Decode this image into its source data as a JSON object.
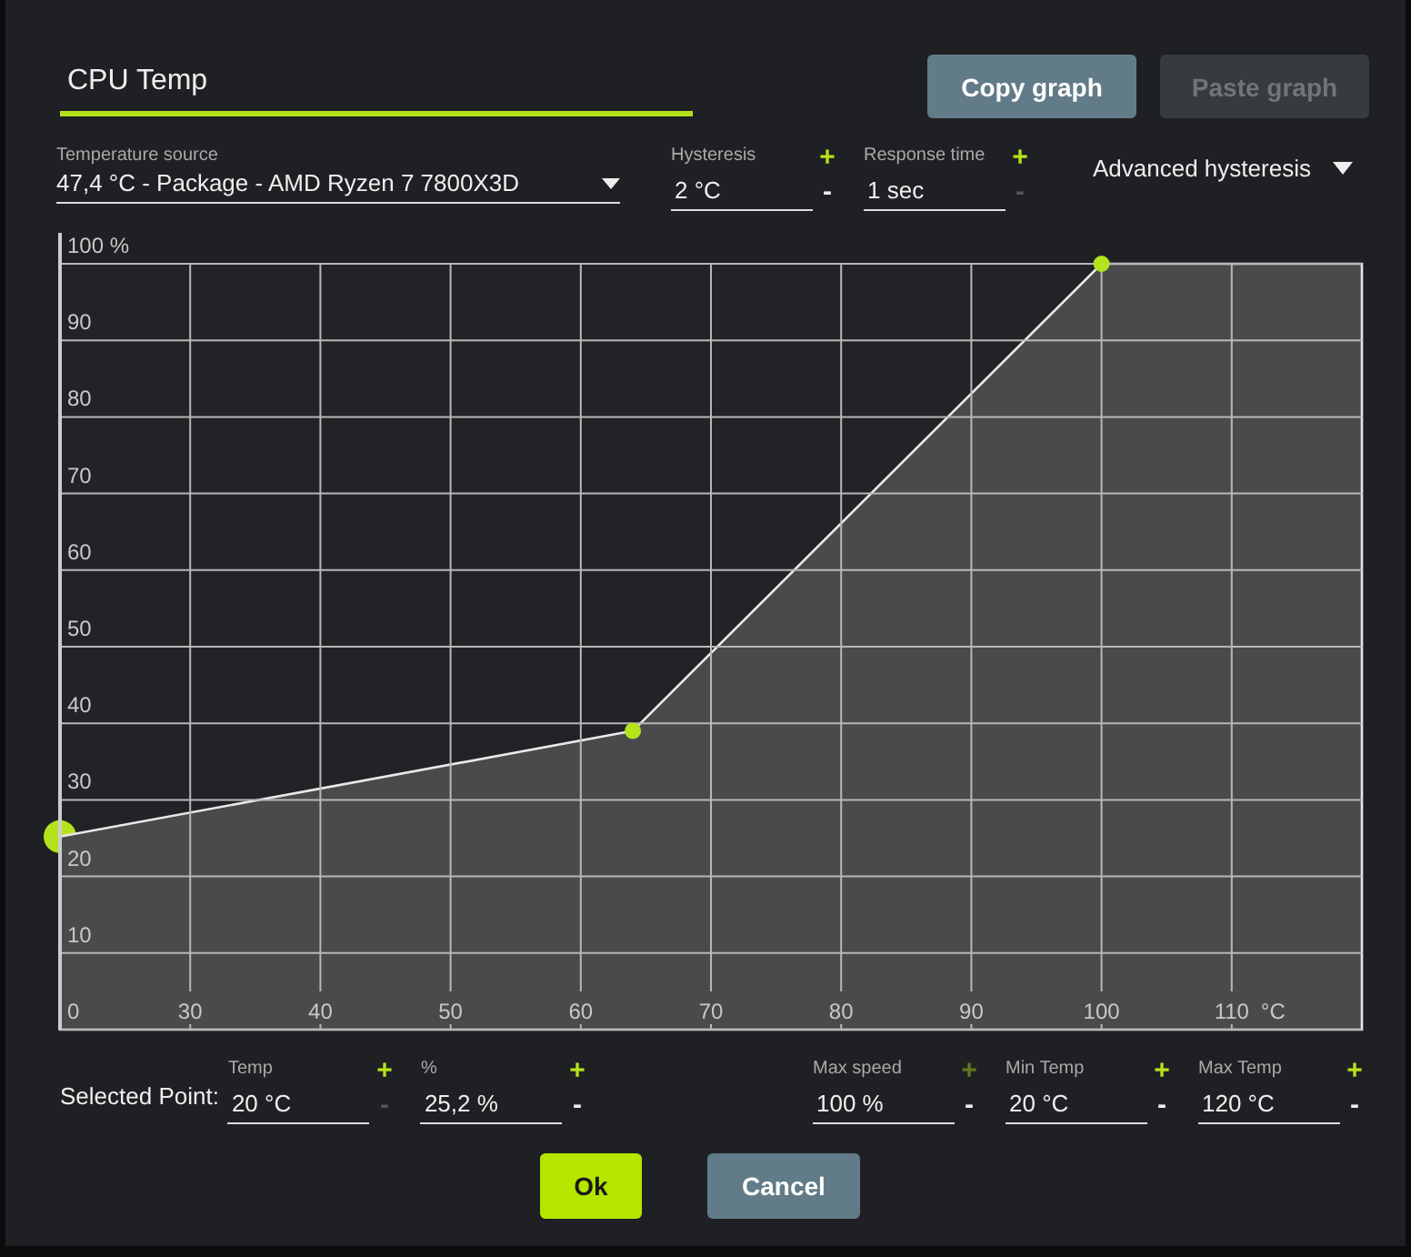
{
  "title_field": {
    "value": "CPU Temp"
  },
  "buttons": [
    {
      "label": "Copy graph",
      "disabled": false
    },
    {
      "label": "Paste graph",
      "disabled": true
    }
  ],
  "temperature_source": {
    "label": "Temperature source",
    "value": "47,4 °C - Package - AMD Ryzen 7 7800X3D"
  },
  "settings": [
    {
      "label": "Hysteresis",
      "value": "2 °C",
      "plus": "+",
      "minus": "-",
      "plus_disabled": false,
      "minus_disabled": false
    },
    {
      "label": "Response time",
      "value": "1 sec",
      "plus": "+",
      "minus": "-",
      "plus_disabled": false,
      "minus_disabled": true
    }
  ],
  "advanced_hysteresis": {
    "label": "Advanced hysteresis"
  },
  "chart_data": {
    "type": "area",
    "x": [
      20,
      64,
      100,
      120
    ],
    "series": [
      {
        "color": "#4a4a4c",
        "values": [
          25.2,
          39,
          100,
          100
        ]
      }
    ],
    "xlim": [
      20,
      120
    ],
    "ylim": [
      0,
      100
    ],
    "xticks": [
      30,
      40,
      50,
      60,
      70,
      80,
      90,
      100,
      110
    ],
    "xlabel": "°C",
    "grid": true,
    "yticks": [
      {
        "value": 0,
        "label": "0"
      },
      10,
      20,
      30,
      40,
      50,
      60,
      70,
      80,
      90,
      {
        "value": 100,
        "label": "100 %"
      }
    ]
  },
  "curve_points": [
    {
      "selected": true
    },
    {
      "selected": false
    },
    {
      "selected": false
    }
  ],
  "selected_point": {
    "label": "Selected Point:",
    "fields": [
      {
        "label": "Temp",
        "value": "20 °C",
        "plus": "+",
        "minus": "-",
        "plus_disabled": false,
        "minus_disabled": true
      },
      {
        "label": "%",
        "value": "25,2 %",
        "plus": "+",
        "minus": "-",
        "plus_disabled": false,
        "minus_disabled": false
      }
    ]
  },
  "limits": [
    {
      "label": "Max speed",
      "value": "100 %",
      "plus": "+",
      "minus": "-",
      "plus_disabled": true,
      "minus_disabled": false
    },
    {
      "label": "Min Temp",
      "value": "20 °C",
      "plus": "+",
      "minus": "-",
      "plus_disabled": false,
      "minus_disabled": false
    },
    {
      "label": "Max Temp",
      "value": "120 °C",
      "plus": "+",
      "minus": "-",
      "plus_disabled": false,
      "minus_disabled": false
    }
  ],
  "dialog_buttons": [
    {
      "label": "Ok",
      "kind": "primary"
    },
    {
      "label": "Cancel",
      "kind": "secondary"
    }
  ]
}
